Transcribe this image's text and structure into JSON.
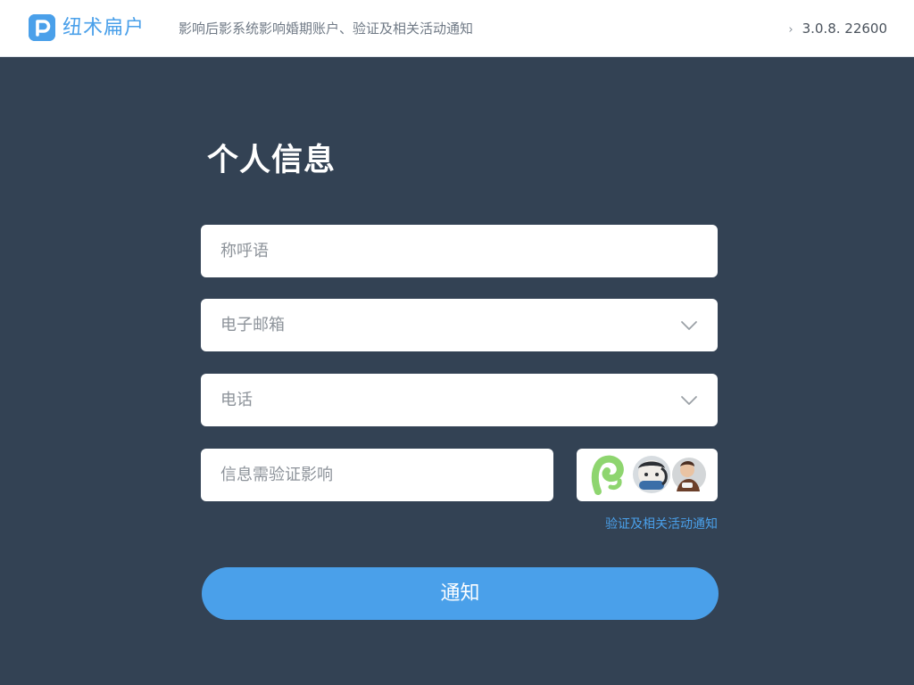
{
  "header": {
    "brand_name": "纽术扁户",
    "message": "影响后影系统影响婚期账户、验证及相关活动通知",
    "right_text": "3.0.8.  22600"
  },
  "form": {
    "title": "个人信息",
    "fields": [
      {
        "placeholder": "称呼语",
        "has_dropdown": false
      },
      {
        "placeholder": "电子邮箱",
        "has_dropdown": true
      },
      {
        "placeholder": "电话",
        "has_dropdown": true
      },
      {
        "placeholder": "信息需验证影响",
        "has_dropdown": false
      }
    ],
    "verify_link": "验证及相关活动通知",
    "submit_label": "通知"
  },
  "colors": {
    "accent": "#4aa0ea",
    "background": "#334254",
    "header_bg": "#ffffff",
    "field_bg": "#ffffff"
  },
  "icons": {
    "logo": "p-logo-icon",
    "dropdown": "chevron-down-icon",
    "header_chevron": "chevron-right-icon"
  }
}
